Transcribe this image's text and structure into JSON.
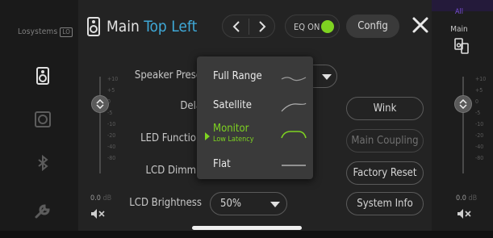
{
  "brand": {
    "name": "Losystems",
    "badge": "LO"
  },
  "header": {
    "title_prefix": "Main",
    "title_accent": "Top Left",
    "eq_label": "EQ ON",
    "config_label": "Config"
  },
  "settings": {
    "speaker_preset_label": "Speaker Prese",
    "delay_label": "Dela",
    "led_function_label": "LED Functio",
    "lcd_dimmer_label": "LCD Dimm",
    "lcd_brightness_label": "LCD Brightness",
    "lcd_brightness_value": "50%"
  },
  "buttons": {
    "wink": "Wink",
    "main_coupling": "Main Coupling",
    "factory_reset": "Factory Reset",
    "system_info": "System Info"
  },
  "dropdown": {
    "options": [
      {
        "label": "Full Range",
        "sub": ""
      },
      {
        "label": "Satellite",
        "sub": ""
      },
      {
        "label": "Monitor",
        "sub": "Low Latency"
      },
      {
        "label": "Flat",
        "sub": ""
      }
    ],
    "selected_index": 2
  },
  "left_fader": {
    "scale": [
      "+10",
      "+5",
      "0",
      "-5",
      "-10",
      "-20",
      "-40",
      "-80"
    ],
    "value": "0.0",
    "unit": "dB"
  },
  "right_panel": {
    "top_label": "All",
    "group_label": "Main",
    "scale": [
      "+10",
      "+5",
      "0",
      "-5",
      "-10",
      "-20",
      "-40",
      "-80"
    ],
    "value": "0.0",
    "unit": "dB"
  },
  "colors": {
    "accent_blue": "#3fa9d8",
    "accent_green": "#7ed321",
    "accent_purple": "#7a4fd8"
  }
}
